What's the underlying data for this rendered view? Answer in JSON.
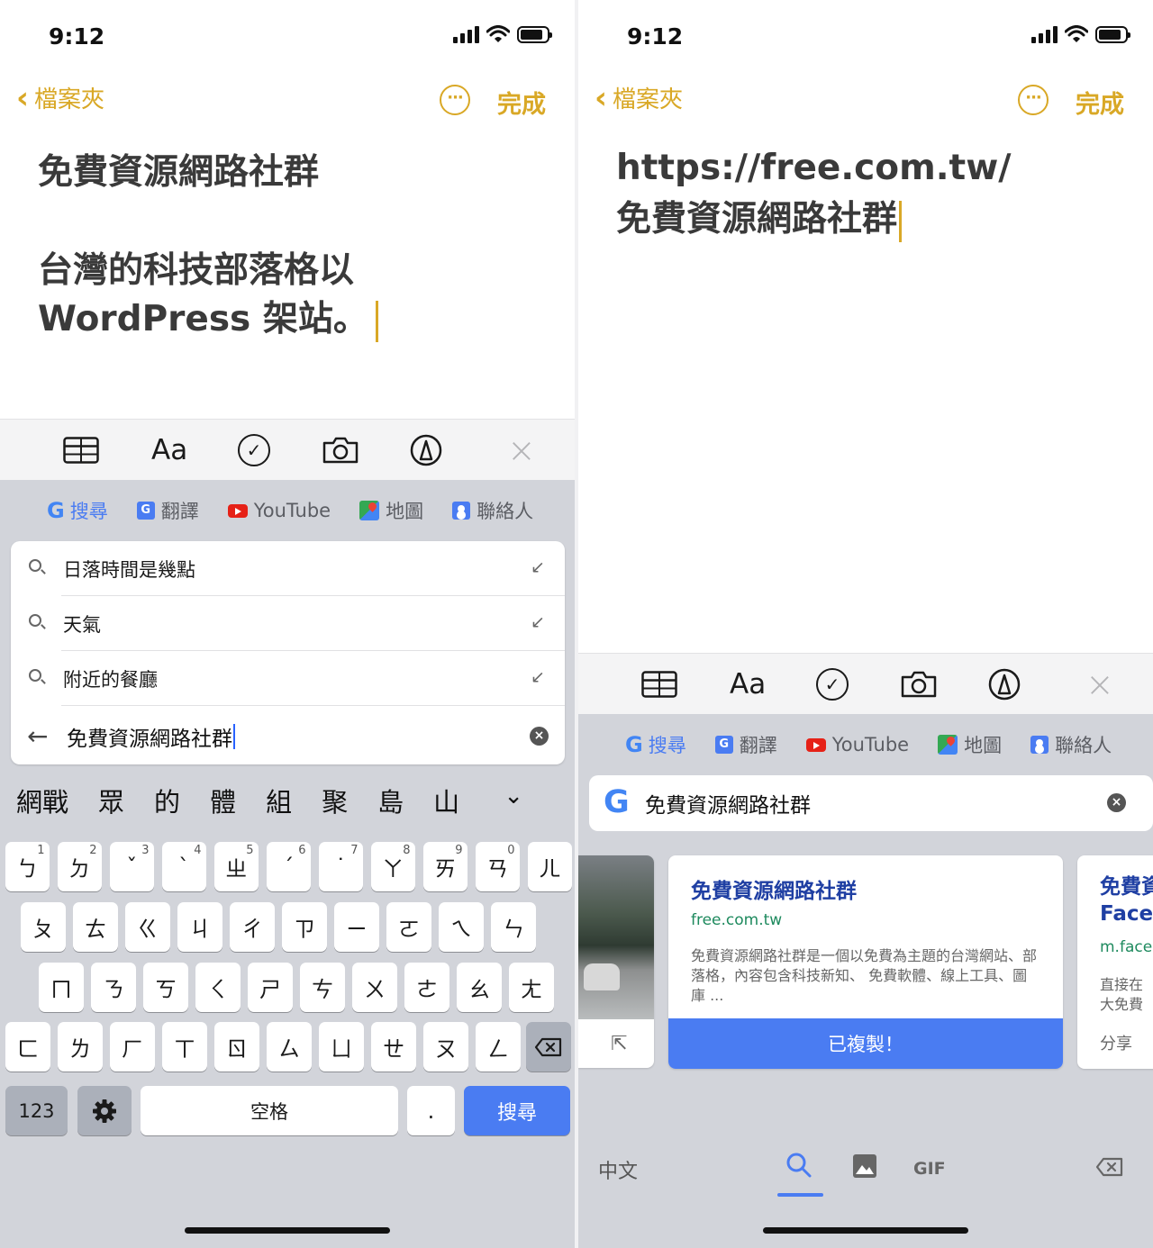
{
  "status": {
    "time": "9:12"
  },
  "nav": {
    "back_label": "檔案夾",
    "more_label": "···",
    "done_label": "完成"
  },
  "left": {
    "note_title": "免費資源網路社群",
    "note_text": "台灣的科技部落格以 WordPress 架站。",
    "suggestions": [
      "日落時間是幾點",
      "天氣",
      "附近的餐廳"
    ],
    "query": "免費資源網路社群",
    "candidates": [
      "網戰",
      "眾",
      "的",
      "體",
      "組",
      "聚",
      "島",
      "山"
    ],
    "keyboard": {
      "row1": [
        {
          "k": "ㄅ",
          "n": "1"
        },
        {
          "k": "ㄉ",
          "n": "2"
        },
        {
          "k": "ˇ",
          "n": "3"
        },
        {
          "k": "ˋ",
          "n": "4"
        },
        {
          "k": "ㄓ",
          "n": "5"
        },
        {
          "k": "ˊ",
          "n": "6"
        },
        {
          "k": "˙",
          "n": "7"
        },
        {
          "k": "ㄚ",
          "n": "8"
        },
        {
          "k": "ㄞ",
          "n": "9"
        },
        {
          "k": "ㄢ",
          "n": "0"
        },
        {
          "k": "ㄦ",
          "n": ""
        }
      ],
      "row2": [
        "ㄆ",
        "ㄊ",
        "ㄍ",
        "ㄐ",
        "ㄔ",
        "ㄗ",
        "ㄧ",
        "ㄛ",
        "ㄟ",
        "ㄣ"
      ],
      "row3": [
        "ㄇ",
        "ㄋ",
        "ㄎ",
        "ㄑ",
        "ㄕ",
        "ㄘ",
        "ㄨ",
        "ㄜ",
        "ㄠ",
        "ㄤ"
      ],
      "row4": [
        "ㄈ",
        "ㄌ",
        "ㄏ",
        "ㄒ",
        "ㄖ",
        "ㄙ",
        "ㄩ",
        "ㄝ",
        "ㄡ",
        "ㄥ"
      ],
      "num_label": "123",
      "space_label": "空格",
      "period_label": ".",
      "search_label": "搜尋"
    }
  },
  "right": {
    "note_line1": "https://free.com.tw/",
    "note_line2": "免費資源網路社群",
    "query": "免費資源網路社群",
    "card1": {
      "title": "免費資源網路社群",
      "url": "free.com.tw",
      "desc": "免費資源網路社群是一個以免費為主題的台灣網站、部落格，內容包含科技新知、 免費軟體、線上工具、圖庫 ...",
      "button": "已複製！"
    },
    "card2": {
      "title_line1": "免費資",
      "title_line2": "Faceb",
      "url": "m.face",
      "desc_line1": "直接在",
      "desc_line2": "大免費",
      "share_label": "分享"
    },
    "bottom": {
      "lang_label": "中文",
      "gif_label": "GIF"
    }
  },
  "toolbar": {
    "aa_label": "Aa"
  },
  "quick_bar": {
    "search_label": "搜尋",
    "translate_label": "翻譯",
    "youtube_label": "YouTube",
    "maps_label": "地圖",
    "contacts_label": "聯絡人"
  },
  "colors": {
    "accent": "#d9a826",
    "keyboard_blue": "#4a7cf2",
    "keyboard_bg": "#d2d4da"
  },
  "icons": [
    "signal-icon",
    "wifi-icon",
    "battery-icon",
    "chevron-left-icon",
    "more-icon",
    "table-icon",
    "checklist-icon",
    "camera-icon",
    "markup-icon",
    "close-icon",
    "google-icon",
    "translate-icon",
    "youtube-icon",
    "maps-icon",
    "contacts-icon",
    "search-icon",
    "arrow-icon",
    "clear-icon",
    "chevron-down-icon",
    "gear-icon",
    "delete-icon",
    "share-icon",
    "image-icon",
    "gif-icon"
  ]
}
